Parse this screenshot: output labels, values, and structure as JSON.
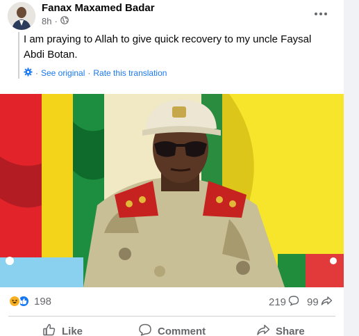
{
  "post": {
    "author": "Fanax Maxamed Badar",
    "time": "8h",
    "audience_icon": "globe-icon",
    "text": "I am praying to Allah to give quick recovery to my uncle Faysal Abdi Botan.",
    "see_original": "See original",
    "separator": "·",
    "rate_translation": "Rate this translation"
  },
  "stats": {
    "reactions_count": "198",
    "comments_count": "219",
    "shares_count": "99",
    "reaction_icons": [
      "haha-icon",
      "like-icon"
    ]
  },
  "actions": {
    "like": "Like",
    "comment": "Comment",
    "share": "Share"
  },
  "colors": {
    "link_blue": "#1877f2",
    "secondary_text": "#65676b",
    "divider": "#ced0d4",
    "card_bg": "#ffffff",
    "page_bg": "#f0f2f5"
  }
}
